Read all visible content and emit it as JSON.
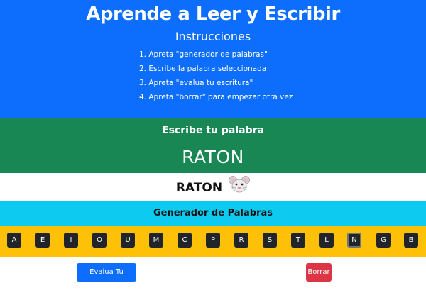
{
  "header": {
    "title": "Aprende a Leer y Escribir",
    "instructions_title": "Instrucciones",
    "steps": [
      "1. Apreta \"generador de palabras\"",
      "2. Escribe la palabra seleccionada",
      "3. Apreta \"evalua tu escritura\"",
      "4. Apreta \"borrar\" para empezar otra vez"
    ]
  },
  "write": {
    "title": "Escribe tu palabra",
    "word": "RATON"
  },
  "result": {
    "word": "RATON",
    "icon": "mouse-icon"
  },
  "generator": {
    "title": "Generador de Palabras",
    "letters": [
      "A",
      "E",
      "I",
      "O",
      "U",
      "M",
      "C",
      "P",
      "R",
      "S",
      "T",
      "L",
      "N",
      "G",
      "B"
    ],
    "selected": "N"
  },
  "buttons": {
    "evaluate": "Evalua Tu escritura",
    "clear": "Borrar"
  },
  "colors": {
    "header": "#0d6efd",
    "write_band": "#198754",
    "generator_bar": "#0dcaf0",
    "letters_bar": "#ffc107",
    "letter_button": "#212529",
    "evaluate_button": "#0d6efd",
    "clear_button": "#dc3545"
  }
}
